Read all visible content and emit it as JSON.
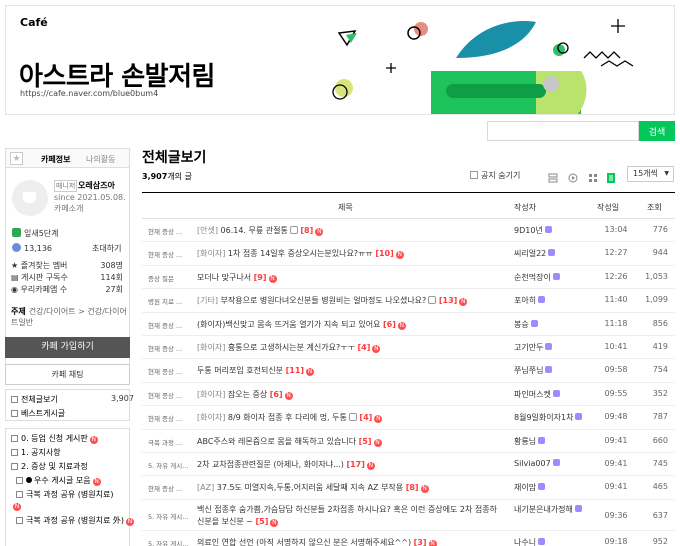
{
  "banner": {
    "logo": "Café",
    "title": "아스트라 손발저림",
    "url": "https://cafe.naver.com/blue0bum4"
  },
  "search": {
    "placeholder": "",
    "button": "검색"
  },
  "sidebar": {
    "tab_info": "카페정보",
    "tab_activity": "나의활동",
    "manager_badge": "매니저",
    "manager_name": "오레삼즈아",
    "since": "since 2021.05.08.",
    "intro": "카페소개",
    "level": "잎새5단계",
    "members": "13,136",
    "invite": "초대하기",
    "stats": [
      {
        "label": "즐겨찾는 멤버",
        "value": "308명"
      },
      {
        "label": "게시판 구독수",
        "value": "114회"
      },
      {
        "label": "우리카페앱 수",
        "value": "27회"
      }
    ],
    "theme_label": "주제",
    "theme_text": "건강/다이어트 > 건강/다이어트일반",
    "join": "카페 가입하기",
    "chat": "카페 채팅",
    "menus": [
      {
        "label": "전체글보기",
        "count": "3,907"
      },
      {
        "label": "베스트게시글",
        "count": ""
      }
    ],
    "boards": [
      "0. 등업 신청 게시판",
      "1. 공지사항",
      "2. 증상 및 치료과정",
      "우수 게시글 모음",
      "극복 과정 공유 (병원치료)",
      "극복 과정 공유 (병원치료 外)"
    ]
  },
  "main": {
    "title": "전체글보기",
    "count_num": "3,907",
    "count_suffix": "개의 글",
    "notice_hide": "공지 숨기기",
    "per_page": "15개씩",
    "cols": {
      "title": "제목",
      "author": "작성자",
      "date": "작성일",
      "views": "조회"
    },
    "rows": [
      {
        "cat": "현재 증상 ...",
        "head": "[안셋]",
        "title": " 06.14. 무릎 관절통",
        "icon": true,
        "comments": "[8]",
        "new": true,
        "author": "9D10년",
        "lv": true,
        "date": "13:04",
        "views": "776"
      },
      {
        "cat": "현재 증상 ...",
        "head": "[화이자]",
        "title": " 1차 접종 14일후 증상오시는분있나요?ㅠㅠ",
        "icon": false,
        "comments": "[10]",
        "new": true,
        "author": "씨리얼22",
        "lv": true,
        "date": "12:27",
        "views": "944"
      },
      {
        "cat": "증상 질문",
        "head": "",
        "title": "모더나 맞구나서",
        "icon": false,
        "comments": "[9]",
        "new": true,
        "author": "순천먹장이",
        "lv": true,
        "date": "12:26",
        "views": "1,053"
      },
      {
        "cat": "병원 치료 ...",
        "head": "[기타]",
        "title": " 부작용으로 병원다녀오신분들 병원비는 얼마정도 나오셨나요?",
        "icon": true,
        "comments": "[13]",
        "new": true,
        "author": "포아히",
        "lv": true,
        "date": "11:40",
        "views": "1,099"
      },
      {
        "cat": "현재 증상 ...",
        "head": "",
        "title": "(화이자)백신맞고 몸속 뜨거움 열기가 지속 되고 있어요",
        "icon": false,
        "comments": "[6]",
        "new": true,
        "author": "봉승",
        "lv": true,
        "date": "11:18",
        "views": "856"
      },
      {
        "cat": "현재 증상 ...",
        "head": "[화이자]",
        "title": " 흉통으로 고생하시는분 계신가요?ㅜㅜ",
        "icon": false,
        "comments": "[4]",
        "new": true,
        "author": "고기만두",
        "lv": true,
        "date": "10:41",
        "views": "419"
      },
      {
        "cat": "현재 증상 ...",
        "head": "",
        "title": "두통 머리쪼임 호전되신분",
        "icon": false,
        "comments": "[11]",
        "new": true,
        "author": "쭈님쭈님",
        "lv": true,
        "date": "09:58",
        "views": "754"
      },
      {
        "cat": "현재 증상 ...",
        "head": "[화이자]",
        "title": " 잠오는 증상",
        "icon": false,
        "comments": "[6]",
        "new": true,
        "author": "파인머스켓",
        "lv": true,
        "date": "09:55",
        "views": "352"
      },
      {
        "cat": "현재 증상 ...",
        "head": "[화이자]",
        "title": " 8/9 화이자 접종 후 다리에 멍, 두통",
        "icon": true,
        "comments": "[4]",
        "new": true,
        "author": "8월9일화이자1차",
        "lv": true,
        "date": "09:48",
        "views": "787"
      },
      {
        "cat": "극복 과정 ...",
        "head": "",
        "title": "ABC주스와 레몬즙으로 몸을 해독하고 있습니다",
        "icon": false,
        "comments": "[5]",
        "new": true,
        "author": "황룡님",
        "lv": true,
        "date": "09:41",
        "views": "660"
      },
      {
        "cat": "5. 자유 게시...",
        "head": "",
        "title": "2차 교차접종관련질문 (아제나, 화이자냐...)",
        "icon": false,
        "comments": "[17]",
        "new": true,
        "author": "Silvia007",
        "lv": true,
        "date": "09:41",
        "views": "745"
      },
      {
        "cat": "현재 증상 ...",
        "head": "[AZ]",
        "title": " 37.5도 미열지속,두통,어지러움 세달째 지속 AZ 부작용",
        "icon": false,
        "comments": "[8]",
        "new": true,
        "author": "재이맘",
        "lv": true,
        "date": "09:41",
        "views": "465"
      },
      {
        "cat": "5. 자유 게시...",
        "head": "",
        "title": "백신 접종후 숨가쁨,가슴답답 하신분들 2차접종 하시나요? 혹은 이런 증상에도 2차 접종하신분을 보신분 ~",
        "icon": false,
        "comments": "[5]",
        "new": true,
        "author": "내기분은내가정해",
        "lv": true,
        "date": "09:36",
        "views": "637",
        "tall": true
      },
      {
        "cat": "5. 자유 게시...",
        "head": "",
        "title": "의료인 연합 선언 (아직 서명하지 않으신 분은 서명해주세요^^)",
        "icon": false,
        "comments": "[3]",
        "new": true,
        "author": "나수니",
        "lv": true,
        "date": "09:18",
        "views": "952"
      }
    ]
  }
}
